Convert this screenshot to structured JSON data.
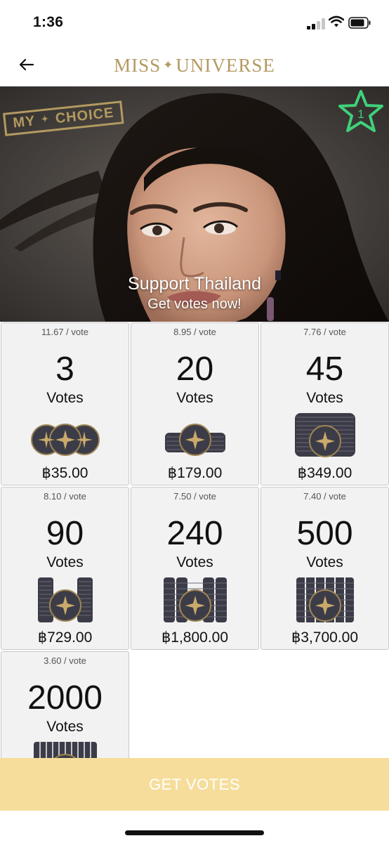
{
  "status_bar": {
    "time": "1:36"
  },
  "nav": {
    "brand_left": "MISS",
    "brand_sep": "✦",
    "brand_right": "UNIVERSE"
  },
  "hero": {
    "badge_left": "MY",
    "badge_sep": "✦",
    "badge_right": "CHOICE",
    "rank": "1",
    "title": "Support Thailand",
    "subtitle": "Get votes now!"
  },
  "packages": [
    {
      "rate": "11.67 / vote",
      "count": "3",
      "unit": "Votes",
      "price": "฿35.00",
      "stack": "three-coins"
    },
    {
      "rate": "8.95 / vote",
      "count": "20",
      "unit": "Votes",
      "price": "฿179.00",
      "stack": "flat-stack"
    },
    {
      "rate": "7.76 / vote",
      "count": "45",
      "unit": "Votes",
      "price": "฿349.00",
      "stack": "tall-stack"
    },
    {
      "rate": "8.10 / vote",
      "count": "90",
      "unit": "Votes",
      "price": "฿729.00",
      "stack": "two-columns"
    },
    {
      "rate": "7.50 / vote",
      "count": "240",
      "unit": "Votes",
      "price": "฿1,800.00",
      "stack": "four-columns"
    },
    {
      "rate": "7.40 / vote",
      "count": "500",
      "unit": "Votes",
      "price": "฿3,700.00",
      "stack": "six-columns"
    },
    {
      "rate": "3.60 / vote",
      "count": "2000",
      "unit": "Votes",
      "price": "",
      "stack": "many-columns"
    }
  ],
  "button": {
    "label": "GET VOTES"
  },
  "colors": {
    "brand_gold": "#b39a62",
    "button_bg": "#f6dd9b",
    "coin_dark": "#3c3c48",
    "rank_green": "#3fd17a"
  }
}
